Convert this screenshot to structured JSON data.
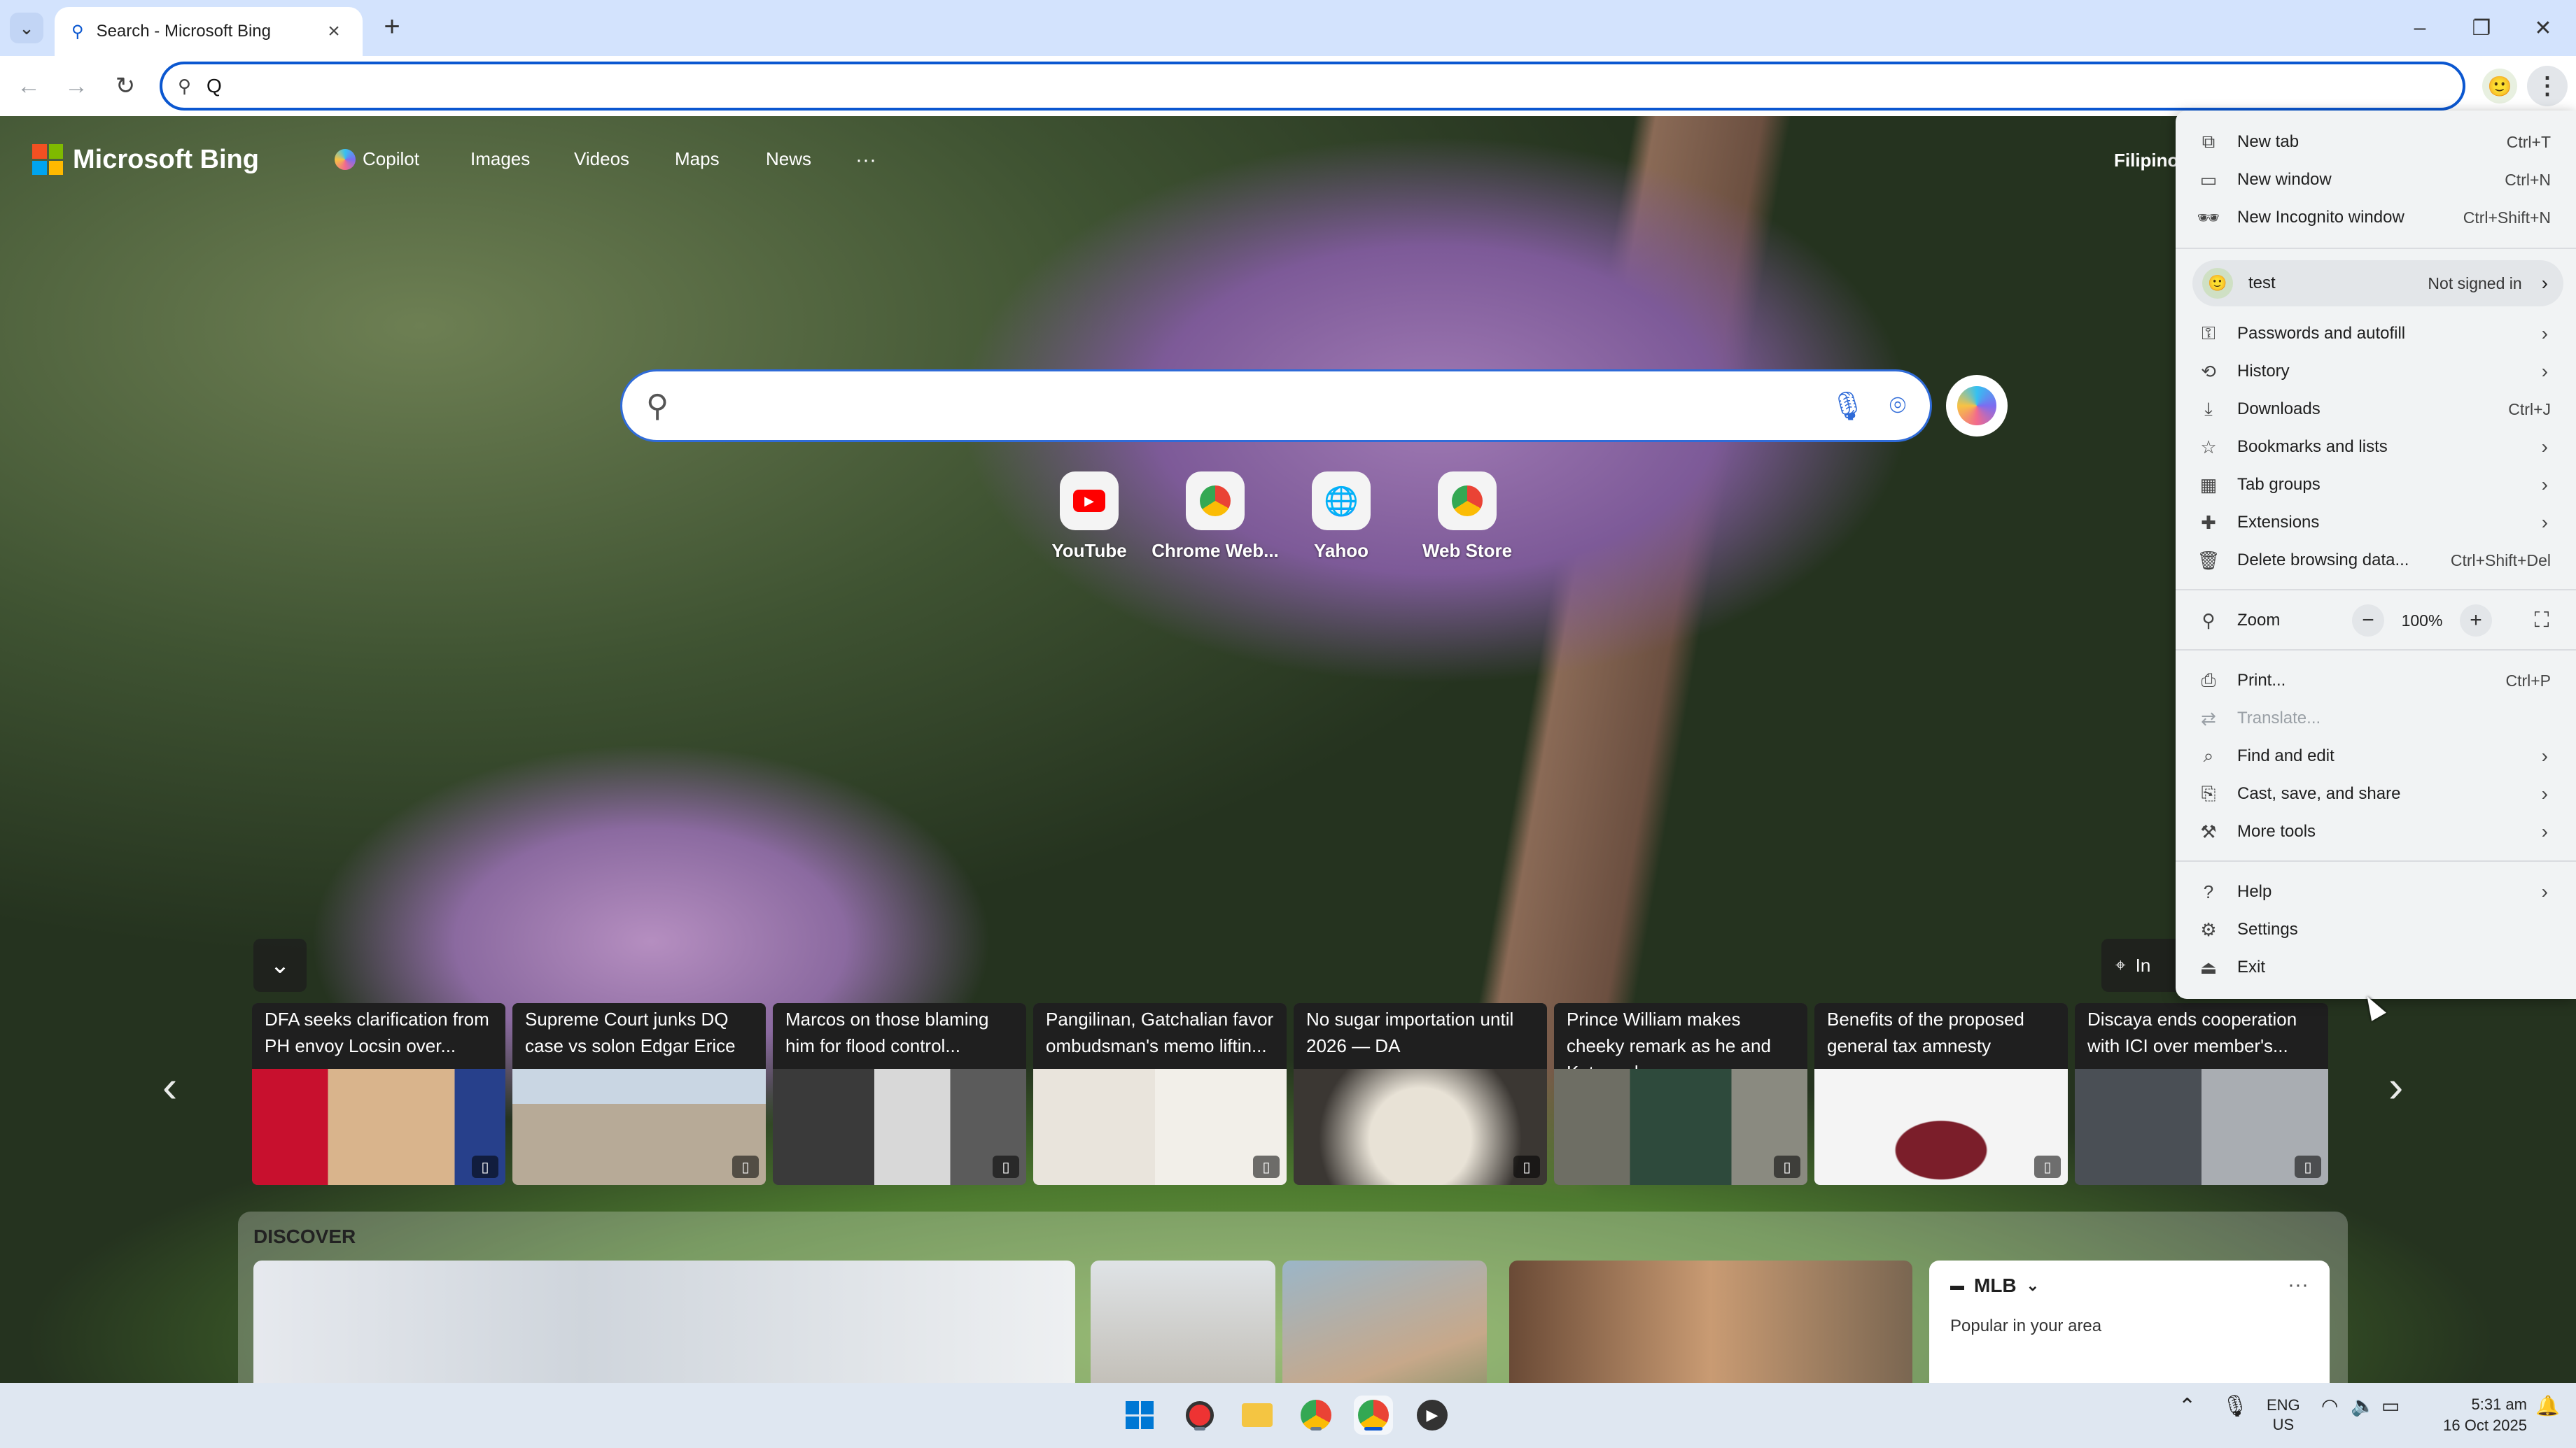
{
  "browser": {
    "tab_title": "Search - Microsoft Bing",
    "omnibox_value": "Q",
    "new_tab_symbol": "+",
    "close_symbol": "×"
  },
  "bing": {
    "logo_text": "Microsoft Bing",
    "nav": [
      "Copilot",
      "Images",
      "Videos",
      "Maps",
      "News"
    ],
    "nav_more": "···",
    "language_link": "Filipino",
    "search_placeholder": "",
    "shortcuts": [
      {
        "label": "YouTube",
        "icon": "youtube-icon"
      },
      {
        "label": "Chrome Web...",
        "icon": "chrome-web-store-icon"
      },
      {
        "label": "Yahoo",
        "icon": "globe-icon"
      },
      {
        "label": "Web Store",
        "icon": "chrome-web-store-icon"
      }
    ],
    "info_label": "In",
    "news": [
      {
        "title": "DFA seeks clarification from PH envoy Locsin over..."
      },
      {
        "title": "Supreme Court junks DQ case vs solon Edgar Erice"
      },
      {
        "title": "Marcos on those blaming him for flood control..."
      },
      {
        "title": "Pangilinan, Gatchalian favor ombudsman's memo liftin..."
      },
      {
        "title": "No sugar importation until 2026 — DA"
      },
      {
        "title": "Prince William makes cheeky remark as he and Kate mak..."
      },
      {
        "title": "Benefits of the proposed general tax amnesty"
      },
      {
        "title": "Discaya ends cooperation with ICI over member's..."
      }
    ],
    "discover_label": "DISCOVER",
    "mlb": {
      "title": "MLB",
      "subtitle": "Popular in your area",
      "more": "···"
    }
  },
  "menu": {
    "new_tab": {
      "label": "New tab",
      "shortcut": "Ctrl+T"
    },
    "new_window": {
      "label": "New window",
      "shortcut": "Ctrl+N"
    },
    "new_incognito": {
      "label": "New Incognito window",
      "shortcut": "Ctrl+Shift+N"
    },
    "profile": {
      "name": "test",
      "status": "Not signed in"
    },
    "passwords": {
      "label": "Passwords and autofill"
    },
    "history": {
      "label": "History"
    },
    "downloads": {
      "label": "Downloads",
      "shortcut": "Ctrl+J"
    },
    "bookmarks": {
      "label": "Bookmarks and lists"
    },
    "tab_groups": {
      "label": "Tab groups"
    },
    "extensions": {
      "label": "Extensions"
    },
    "delete_data": {
      "label": "Delete browsing data...",
      "shortcut": "Ctrl+Shift+Del"
    },
    "zoom": {
      "label": "Zoom",
      "value": "100%",
      "minus": "−",
      "plus": "+"
    },
    "print": {
      "label": "Print...",
      "shortcut": "Ctrl+P"
    },
    "translate": {
      "label": "Translate..."
    },
    "find_edit": {
      "label": "Find and edit"
    },
    "cast_save_share": {
      "label": "Cast, save, and share"
    },
    "more_tools": {
      "label": "More tools"
    },
    "help": {
      "label": "Help"
    },
    "settings": {
      "label": "Settings"
    },
    "exit": {
      "label": "Exit"
    }
  },
  "taskbar": {
    "lang_top": "ENG",
    "lang_bottom": "US",
    "time": "5:31 am",
    "date": "16 Oct 2025"
  },
  "colors": {
    "accent": "#0b57d0",
    "tabstrip": "#d3e3fd",
    "menu_bg": "#f1f3f4",
    "ms_red": "#f25022",
    "ms_green": "#7fba00",
    "ms_blue": "#00a4ef",
    "ms_yellow": "#ffb900"
  }
}
